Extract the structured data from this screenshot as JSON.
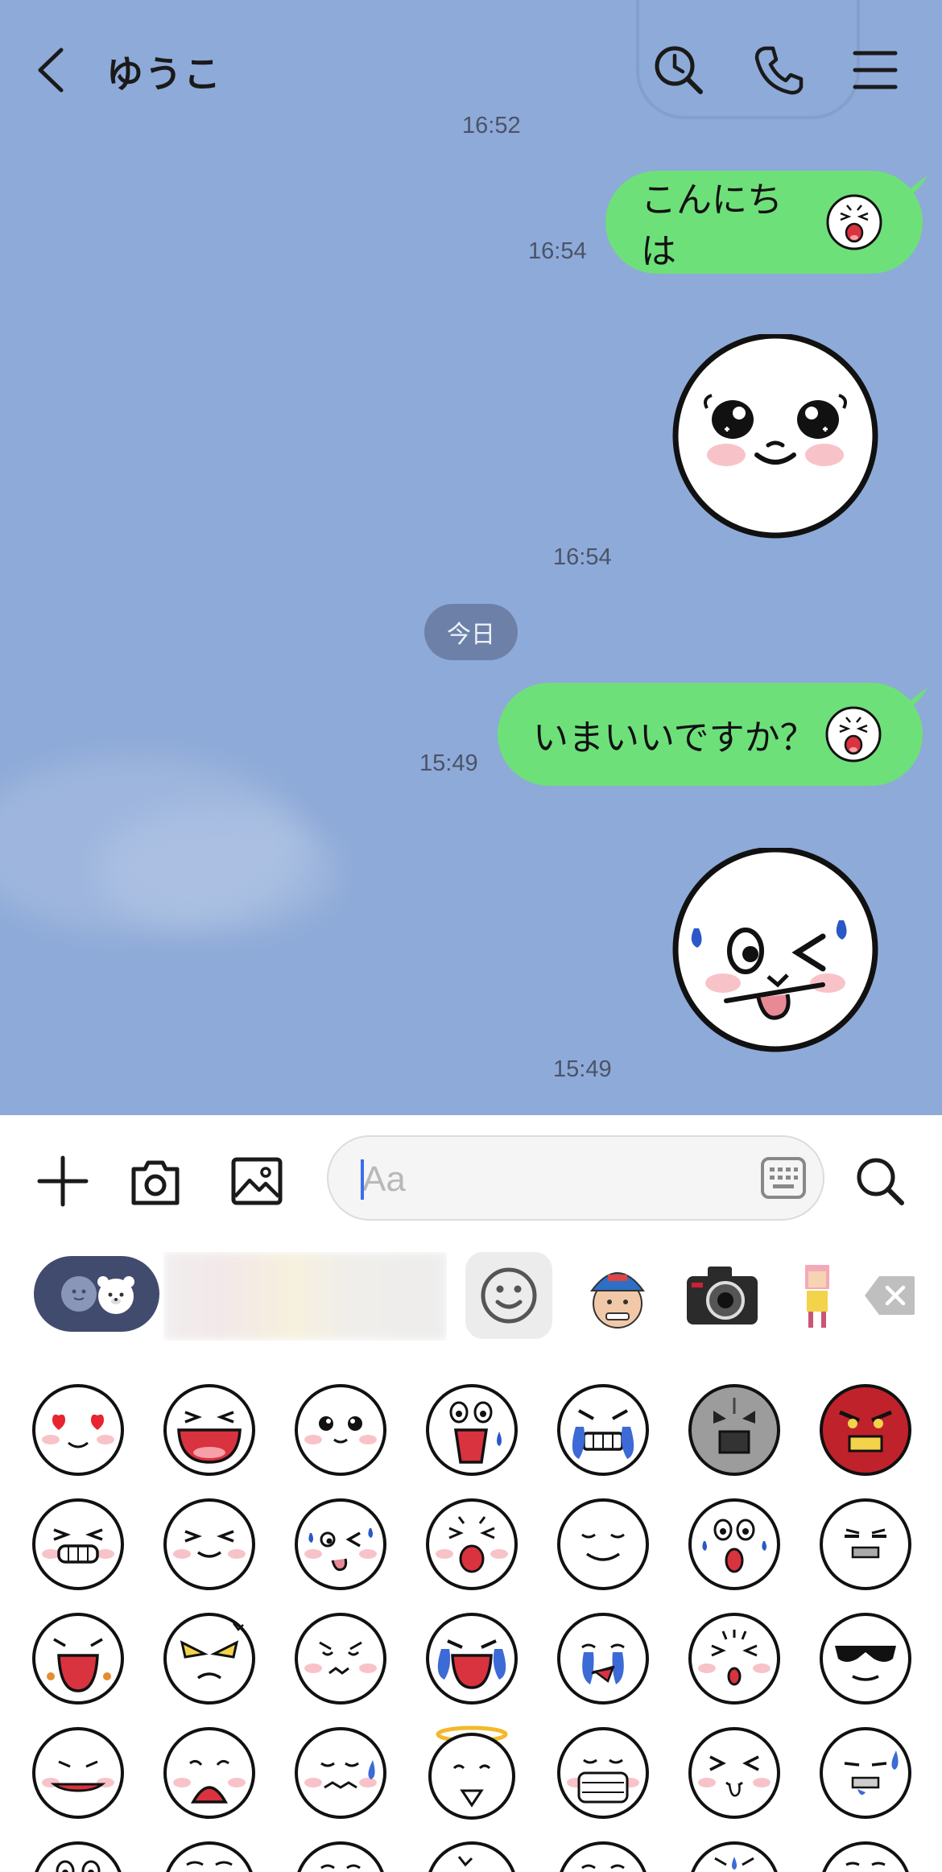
{
  "header": {
    "title": "ゆうこ",
    "icons": [
      "back-chevron-icon",
      "history-search-icon",
      "phone-icon",
      "menu-icon"
    ]
  },
  "messages": {
    "partial_time": "16:52",
    "msg1": {
      "text": "こんにちは",
      "time": "16:54"
    },
    "sticker1": {
      "time": "16:54",
      "icon": "moon-sticker-teary-eyes"
    },
    "date_divider": "今日",
    "msg2": {
      "text": "いまいいですか？",
      "time": "15:49"
    },
    "sticker2": {
      "time": "15:49",
      "icon": "moon-sticker-wink-tongue-sweat"
    }
  },
  "composer": {
    "placeholder": "Aa",
    "icons": [
      "plus-icon",
      "camera-icon",
      "image-icon",
      "keyboard-icon",
      "search-icon"
    ]
  },
  "emoji_panel": {
    "tabs": [
      "emoji-toggle",
      "blurred-tabs",
      "smiley-tab",
      "cap-boy-tab",
      "camera-sticker-tab",
      "pixel-girl-tab",
      "backspace-icon"
    ],
    "colors": {
      "chat_bg": "#8eaad8",
      "bubble": "#6ee07a",
      "accent_caret": "#3a6df0"
    }
  }
}
